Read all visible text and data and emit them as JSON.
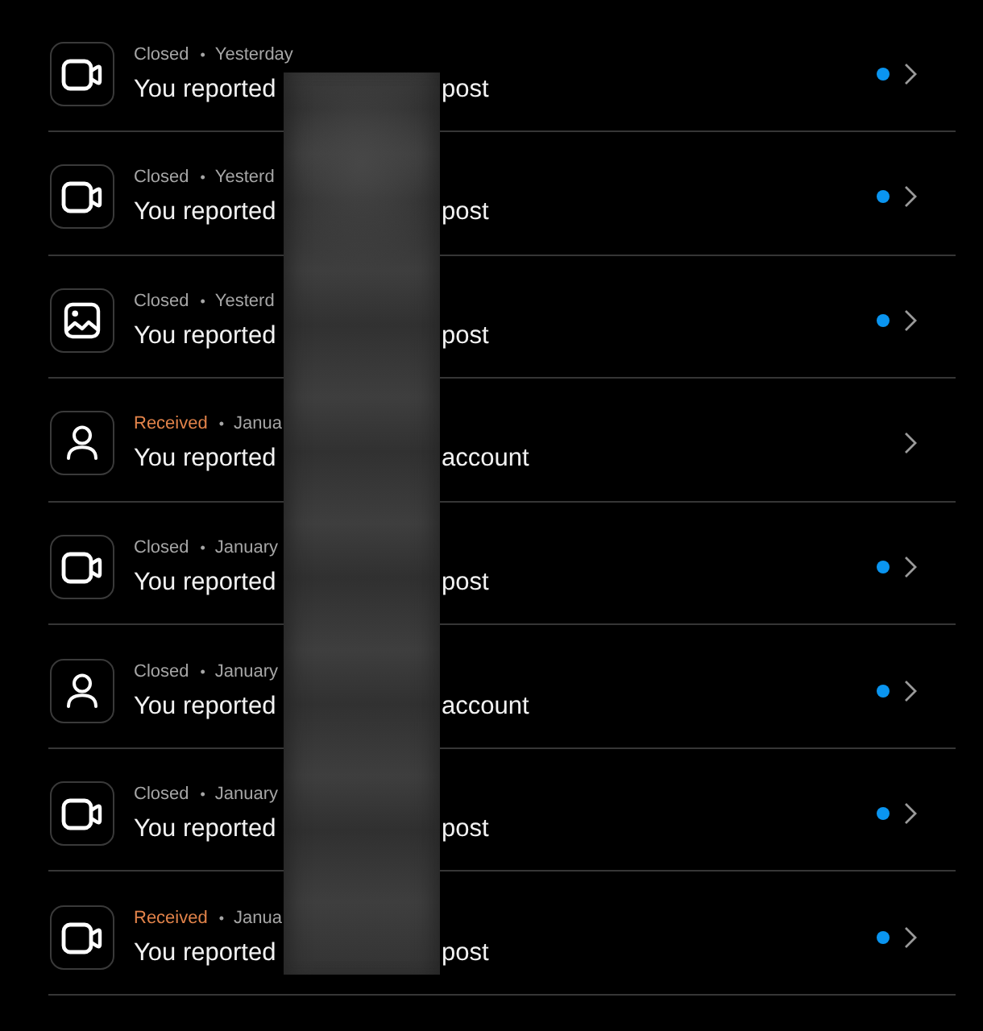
{
  "reports": [
    {
      "kind": "video",
      "status": {
        "kind": "closed",
        "label": "Closed"
      },
      "separator": "•",
      "date": "Yesterday",
      "text_before": "You reported",
      "text_after": "post",
      "unread": true
    },
    {
      "kind": "video",
      "status": {
        "kind": "closed",
        "label": "Closed"
      },
      "separator": "•",
      "date": "Yesterd",
      "text_before": "You reported",
      "text_after": "post",
      "unread": true
    },
    {
      "kind": "image",
      "status": {
        "kind": "closed",
        "label": "Closed"
      },
      "separator": "•",
      "date": "Yesterd",
      "text_before": "You reported",
      "text_after": "post",
      "unread": true
    },
    {
      "kind": "profile",
      "status": {
        "kind": "received",
        "label": "Received"
      },
      "separator": "•",
      "date": "Janua",
      "text_before": "You reported",
      "text_after": "account",
      "unread": false
    },
    {
      "kind": "video",
      "status": {
        "kind": "closed",
        "label": "Closed"
      },
      "separator": "•",
      "date": "January",
      "text_before": "You reported",
      "text_after": "post",
      "unread": true
    },
    {
      "kind": "profile",
      "status": {
        "kind": "closed",
        "label": "Closed"
      },
      "separator": "•",
      "date": "January",
      "text_before": "You reported",
      "text_after": "account",
      "unread": true
    },
    {
      "kind": "video",
      "status": {
        "kind": "closed",
        "label": "Closed"
      },
      "separator": "•",
      "date": "January",
      "text_before": "You reported",
      "text_after": "post",
      "unread": true
    },
    {
      "kind": "video",
      "status": {
        "kind": "received",
        "label": "Received"
      },
      "separator": "•",
      "date": "Janua",
      "text_before": "You reported",
      "text_after": "post",
      "unread": true
    }
  ]
}
